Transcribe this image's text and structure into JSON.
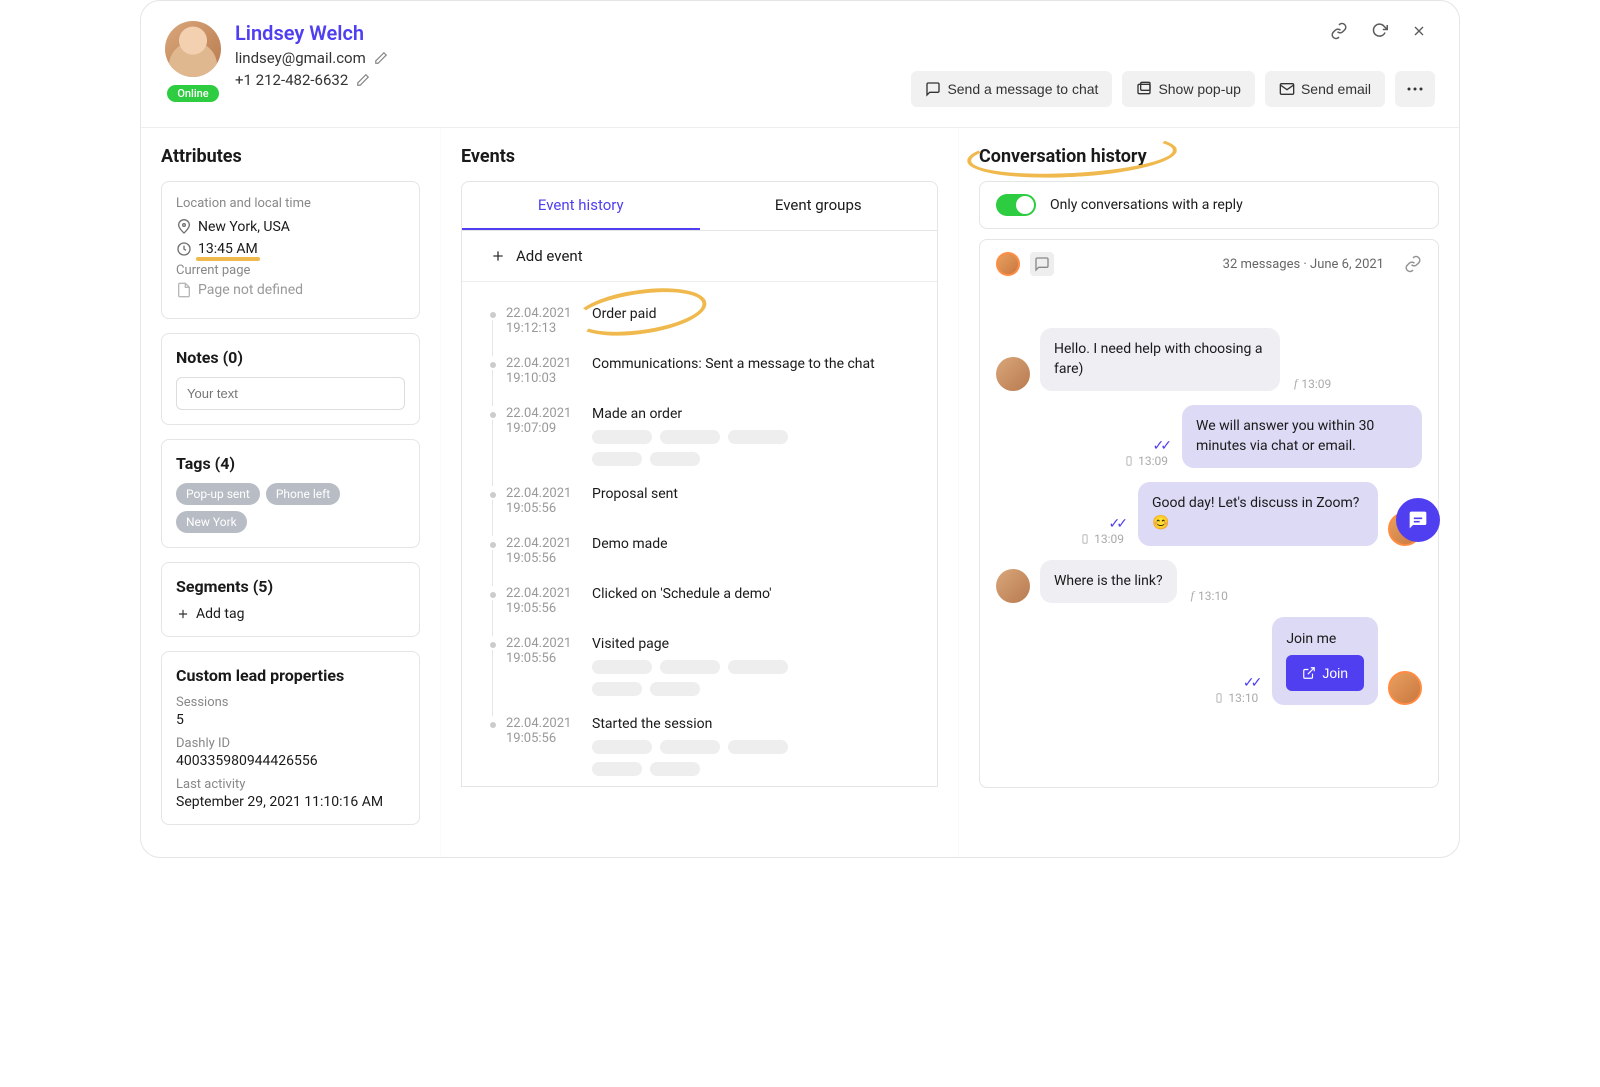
{
  "profile": {
    "name": "Lindsey Welch",
    "email": "lindsey@gmail.com",
    "phone": "+1 212-482-6632",
    "status": "Online"
  },
  "header_buttons": {
    "send_chat": "Send a message to chat",
    "show_popup": "Show pop-up",
    "send_email": "Send email"
  },
  "columns": {
    "attributes_title": "Attributes",
    "events_title": "Events",
    "conversation_title": "Conversation history"
  },
  "attributes": {
    "loc_label": "Location and local time",
    "location": "New York, USA",
    "time": "13:45 AM",
    "current_page_label": "Current page",
    "current_page": "Page not defined",
    "notes_title": "Notes (0)",
    "notes_placeholder": "Your text",
    "tags_title": "Tags (4)",
    "tags": [
      "Pop-up sent",
      "Phone left",
      "New York"
    ],
    "segments_title": "Segments (5)",
    "add_tag": "Add tag",
    "custom_title": "Custom lead properties",
    "sessions_label": "Sessions",
    "sessions_val": "5",
    "dashly_label": "Dashly ID",
    "dashly_val": "400335980944426556",
    "last_label": "Last activity",
    "last_val": "September 29, 2021 11:10:16 AM"
  },
  "events": {
    "tab1": "Event history",
    "tab2": "Event groups",
    "add": "Add event",
    "items": [
      {
        "date": "22.04.2021",
        "time": "19:12:13",
        "title": "Order paid",
        "hl": true
      },
      {
        "date": "22.04.2021",
        "time": "19:10:03",
        "title": "Communications: Sent a message to the chat"
      },
      {
        "date": "22.04.2021",
        "time": "19:07:09",
        "title": "Made an order",
        "sk": true
      },
      {
        "date": "22.04.2021",
        "time": "19:05:56",
        "title": "Proposal sent"
      },
      {
        "date": "22.04.2021",
        "time": "19:05:56",
        "title": "Demo made"
      },
      {
        "date": "22.04.2021",
        "time": "19:05:56",
        "title": "Clicked on 'Schedule a demo'"
      },
      {
        "date": "22.04.2021",
        "time": "19:05:56",
        "title": "Visited page",
        "sk": true
      },
      {
        "date": "22.04.2021",
        "time": "19:05:56",
        "title": "Started the session",
        "sk": true
      }
    ]
  },
  "conversation": {
    "filter_label": "Only conversations with a reply",
    "meta": "32 messages · June 6, 2021",
    "messages": {
      "m1": "Hello. I need help with choosing a fare)",
      "t1": "13:09",
      "m2": "We will answer you within 30 minutes via chat or email.",
      "t2": "13:09",
      "m3": "Good day! Let's discuss in Zoom? 😊",
      "t3": "13:09",
      "m4": "Where is the link?",
      "t4": "13:10",
      "m5": "Join me",
      "t5": "13:10",
      "join": "Join"
    }
  }
}
